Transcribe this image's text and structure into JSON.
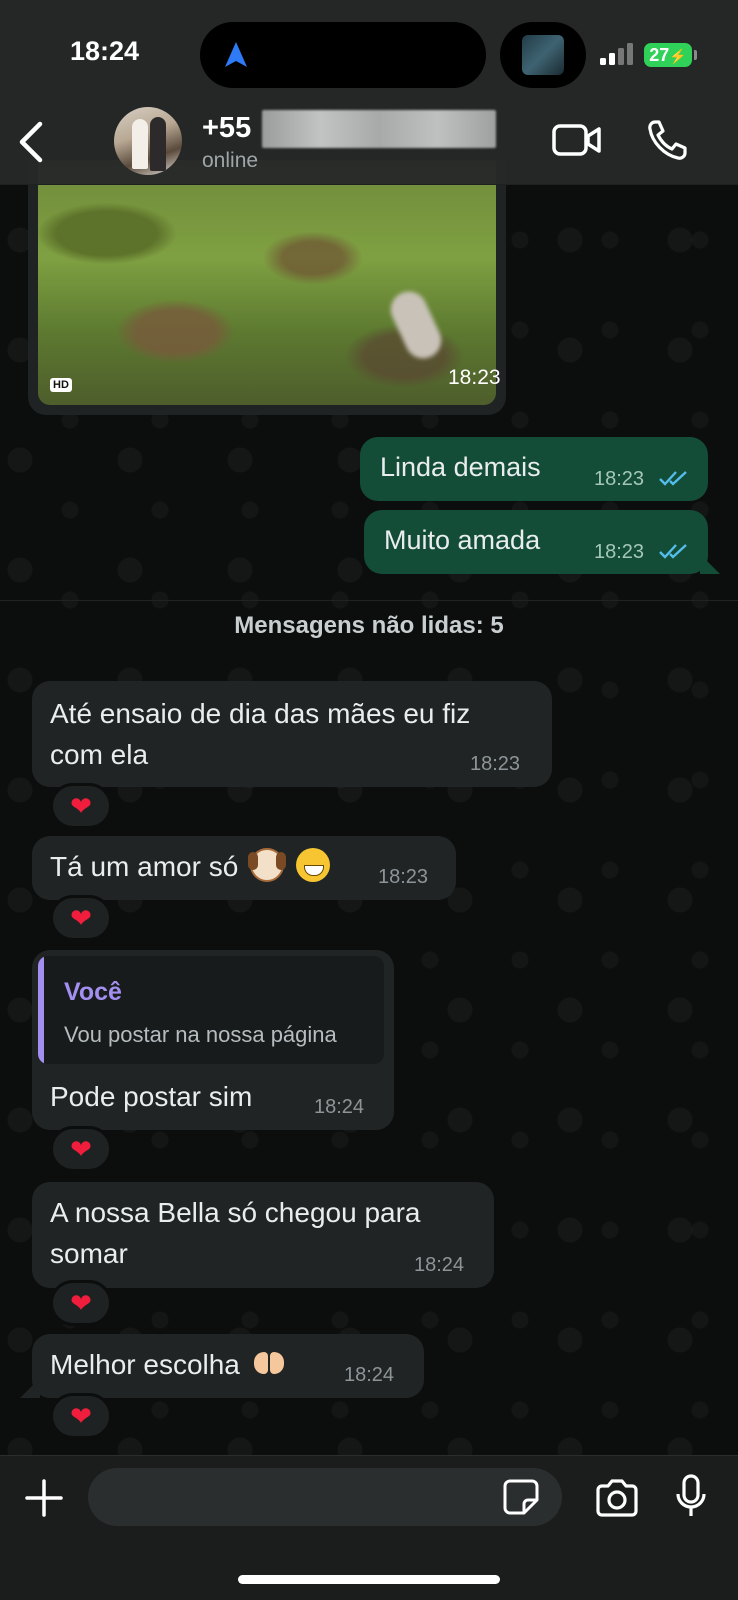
{
  "status_bar": {
    "time": "18:24",
    "battery": "27"
  },
  "header": {
    "contact_name": "+55",
    "contact_status": "online"
  },
  "messages": {
    "media": {
      "time": "18:23",
      "hd_label": "HD"
    },
    "out1": {
      "text": "Linda demais",
      "time": "18:23"
    },
    "out2": {
      "text": "Muito amada",
      "time": "18:23"
    },
    "unread_divider": "Mensagens não lidas: 5",
    "in1": {
      "line1": "Até ensaio de dia das mães eu fiz",
      "line2": "com ela",
      "time": "18:23",
      "reaction": "❤"
    },
    "in2": {
      "text": "Tá um amor só",
      "time": "18:23",
      "reaction": "❤"
    },
    "in3": {
      "quote_author": "Você",
      "quote_text": "Vou postar na nossa página",
      "text": "Pode postar sim",
      "time": "18:24",
      "reaction": "❤"
    },
    "in4": {
      "line1": "A nossa Bella só chegou para",
      "line2": "somar",
      "time": "18:24",
      "reaction": "❤"
    },
    "in5": {
      "text": "Melhor escolha",
      "time": "18:24",
      "reaction": "❤"
    }
  },
  "composer": {
    "placeholder": ""
  },
  "colors": {
    "outgoing_bubble": "#144d37",
    "incoming_bubble": "#202424",
    "quote_accent": "#a38ff0",
    "read_ticks": "#53bdeb",
    "reaction_heart": "#f01e3c"
  }
}
